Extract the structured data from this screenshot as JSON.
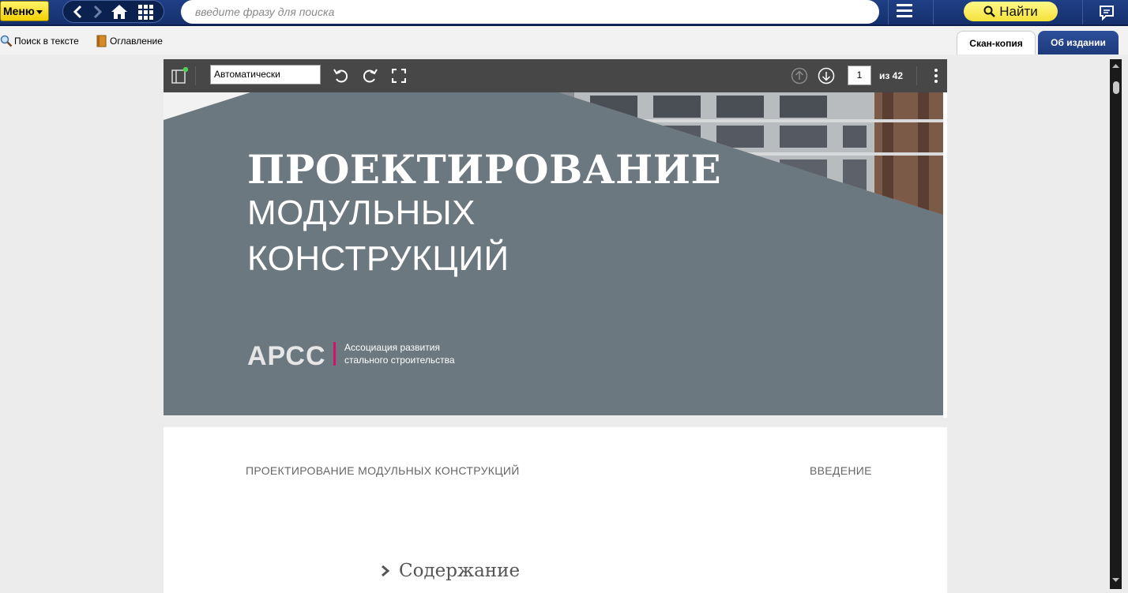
{
  "topbar": {
    "menu_label": "Меню",
    "search_placeholder": "введите фразу для поиска",
    "find_label": "Найти"
  },
  "subbar": {
    "search_in_text": "Поиск в тексте",
    "contents": "Оглавление",
    "tabs": [
      {
        "label": "Скан-копия",
        "active": true
      },
      {
        "label": "Об издании",
        "active": false
      }
    ]
  },
  "viewer": {
    "zoom_value": "Автоматически",
    "current_page": "1",
    "page_total_label": "из 42"
  },
  "page1": {
    "title_bold": "ПРОЕКТИРОВАНИЕ",
    "title_line2": "МОДУЛЬНЫХ",
    "title_line3": "КОНСТРУКЦИЙ",
    "logo_text": "АРСС",
    "logo_caption_line1": "Ассоциация развития",
    "logo_caption_line2": "стального строительства"
  },
  "page2": {
    "header_left": "ПРОЕКТИРОВАНИЕ МОДУЛЬНЫХ КОНСТРУКЦИЙ",
    "header_right": "ВВЕДЕНИЕ",
    "toc_label": "Содержание"
  },
  "colors": {
    "topbar": "#1a3776",
    "accent_yellow": "#f4e13a",
    "cover_gray": "#6b7880",
    "logo_magenta": "#d4126a",
    "pdf_toolbar": "#474747"
  }
}
